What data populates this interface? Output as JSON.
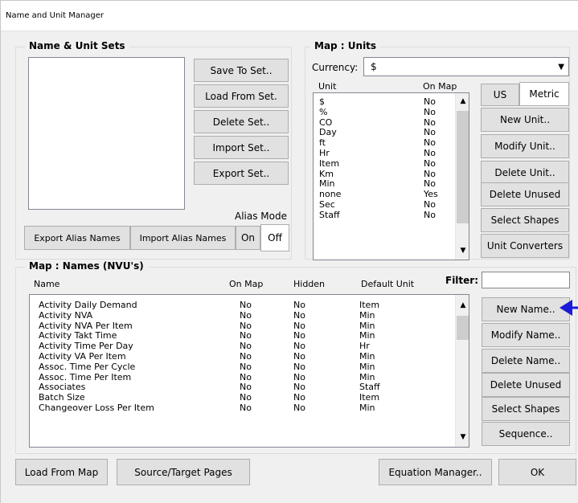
{
  "window": {
    "title": "Name and Unit Manager"
  },
  "sets": {
    "title": "Name & Unit Sets",
    "buttons": [
      "Save To Set..",
      "Load From Set.",
      "Delete Set..",
      "Import Set..",
      "Export Set.."
    ],
    "alias_mode_label": "Alias Mode",
    "export_alias": "Export Alias Names",
    "import_alias": "Import Alias Names",
    "on": "On",
    "off": "Off"
  },
  "units": {
    "title": "Map : Units",
    "currency_label": "Currency:",
    "currency_value": "$",
    "col_unit": "Unit",
    "col_onmap": "On Map",
    "rows": [
      {
        "unit": "$",
        "onmap": "No"
      },
      {
        "unit": "%",
        "onmap": "No"
      },
      {
        "unit": "CO",
        "onmap": "No"
      },
      {
        "unit": "Day",
        "onmap": "No"
      },
      {
        "unit": "ft",
        "onmap": "No"
      },
      {
        "unit": "Hr",
        "onmap": "No"
      },
      {
        "unit": "Item",
        "onmap": "No"
      },
      {
        "unit": "Km",
        "onmap": "No"
      },
      {
        "unit": "Min",
        "onmap": "No"
      },
      {
        "unit": "none",
        "onmap": "Yes"
      },
      {
        "unit": "Sec",
        "onmap": "No"
      },
      {
        "unit": "Staff",
        "onmap": "No"
      }
    ],
    "tab_us": "US",
    "tab_metric": "Metric",
    "buttons": [
      "New Unit..",
      "Modify Unit..",
      "Delete Unit..",
      "Delete Unused",
      "Select Shapes",
      "Unit Converters"
    ]
  },
  "names": {
    "title": "Map : Names (NVU's)",
    "col_name": "Name",
    "col_onmap": "On Map",
    "col_hidden": "Hidden",
    "col_default": "Default Unit",
    "filter_label": "Filter:",
    "filter_value": "",
    "rows": [
      {
        "name": "Activity Daily Demand",
        "onmap": "No",
        "hidden": "No",
        "unit": "Item"
      },
      {
        "name": "Activity NVA",
        "onmap": "No",
        "hidden": "No",
        "unit": "Min"
      },
      {
        "name": "Activity NVA Per Item",
        "onmap": "No",
        "hidden": "No",
        "unit": "Min"
      },
      {
        "name": "Activity Takt Time",
        "onmap": "No",
        "hidden": "No",
        "unit": "Min"
      },
      {
        "name": "Activity Time Per Day",
        "onmap": "No",
        "hidden": "No",
        "unit": "Hr"
      },
      {
        "name": "Activity VA Per Item",
        "onmap": "No",
        "hidden": "No",
        "unit": "Min"
      },
      {
        "name": "Assoc. Time Per Cycle",
        "onmap": "No",
        "hidden": "No",
        "unit": "Min"
      },
      {
        "name": "Assoc. Time Per Item",
        "onmap": "No",
        "hidden": "No",
        "unit": "Min"
      },
      {
        "name": "Associates",
        "onmap": "No",
        "hidden": "No",
        "unit": "Staff"
      },
      {
        "name": "Batch Size",
        "onmap": "No",
        "hidden": "No",
        "unit": "Item"
      },
      {
        "name": "Changeover Loss Per Item",
        "onmap": "No",
        "hidden": "No",
        "unit": "Min"
      }
    ],
    "buttons": [
      "New Name..",
      "Modify Name..",
      "Delete Name..",
      "Delete Unused",
      "Select Shapes",
      "Sequence.."
    ]
  },
  "bottom": {
    "load_from_map": "Load From Map",
    "source_target": "Source/Target Pages",
    "equation_manager": "Equation Manager..",
    "ok": "OK"
  },
  "annotation": {
    "pointer_color": "#1a1adb"
  }
}
